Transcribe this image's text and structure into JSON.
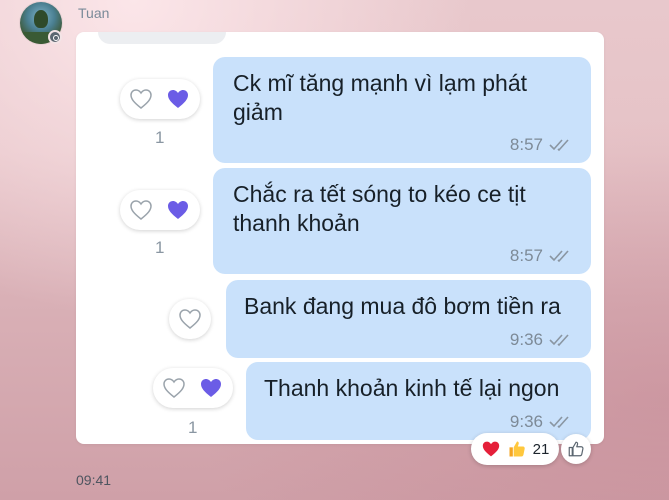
{
  "chat": {
    "sender_name": "Tuan",
    "footer_time": "09:41"
  },
  "messages": [
    {
      "text": "Ck mĩ tăng mạnh vì lạm phát giảm",
      "time": "8:57",
      "reaction_count": "1"
    },
    {
      "text": "Chắc ra tết sóng to kéo ce tịt thanh khoản",
      "time": "8:57",
      "reaction_count": "1"
    },
    {
      "text": "Bank đang mua đô bơm tiền ra",
      "time": "9:36",
      "reaction_count": ""
    },
    {
      "text": "Thanh khoản kinh tế lại ngon",
      "time": "9:36",
      "reaction_count": "1"
    }
  ],
  "summary": {
    "emojis": [
      "heart",
      "thumbs-up"
    ],
    "count": "21"
  },
  "colors": {
    "bubble": "#c9e1fb",
    "heart_purple": "#6b5ce6",
    "heart_red": "#e5203a"
  }
}
